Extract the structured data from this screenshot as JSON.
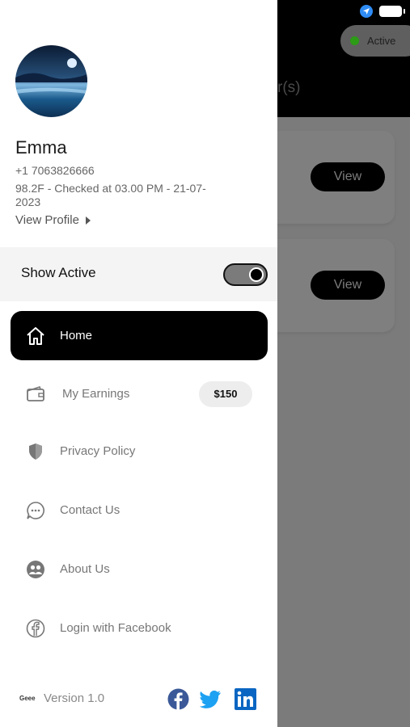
{
  "background": {
    "active_label": "Active",
    "header_partial": "r(s)",
    "cards": [
      {
        "view_label": "View"
      },
      {
        "view_label": "View"
      }
    ]
  },
  "profile": {
    "name": "Emma",
    "phone": "+1 7063826666",
    "status": "98.2F - Checked at 03.00 PM - 21-07-2023",
    "view_profile_label": "View Profile"
  },
  "show_active": {
    "label": "Show Active",
    "enabled": true
  },
  "menu": [
    {
      "label": "Home",
      "icon": "home-icon",
      "active": true
    },
    {
      "label": "My Earnings",
      "icon": "wallet-icon",
      "badge": "$150"
    },
    {
      "label": "Privacy Policy",
      "icon": "shield-icon"
    },
    {
      "label": "Contact Us",
      "icon": "chat-icon"
    },
    {
      "label": "About Us",
      "icon": "users-icon"
    },
    {
      "label": "Login with Facebook",
      "icon": "facebook-icon"
    }
  ],
  "footer": {
    "logo_text": "Geee",
    "version": "Version 1.0",
    "social": [
      "facebook-icon",
      "twitter-icon",
      "linkedin-icon"
    ]
  },
  "colors": {
    "accent_black": "#000000",
    "facebook": "#3b5998",
    "twitter": "#1da1f2",
    "linkedin": "#0a66c2",
    "active_dot": "#2c9b16"
  }
}
